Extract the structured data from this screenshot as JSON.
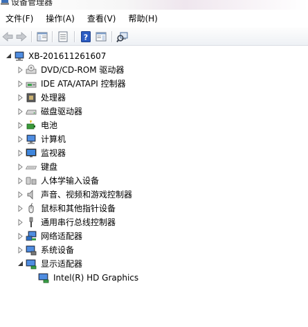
{
  "window": {
    "title": "设备管理器"
  },
  "menu": [
    {
      "label": "文件(F)"
    },
    {
      "label": "操作(A)"
    },
    {
      "label": "查看(V)"
    },
    {
      "label": "帮助(H)"
    }
  ],
  "toolbar": {
    "buttons": [
      "back-arrow-icon",
      "forward-arrow-icon",
      "show-hide-console-tree-icon",
      "properties-icon",
      "help-icon",
      "action-pane-icon",
      "scan-hardware-changes-icon"
    ]
  },
  "tree": {
    "root": {
      "label": "XB-201611261607",
      "expanded": true,
      "icon": "computer-icon"
    },
    "categories": [
      {
        "label": "DVD/CD-ROM 驱动器",
        "icon": "dvd-drive-icon"
      },
      {
        "label": "IDE ATA/ATAPI 控制器",
        "icon": "ide-controller-icon"
      },
      {
        "label": "处理器",
        "icon": "processor-icon"
      },
      {
        "label": "磁盘驱动器",
        "icon": "disk-drive-icon"
      },
      {
        "label": "电池",
        "icon": "battery-icon"
      },
      {
        "label": "计算机",
        "icon": "computer-icon"
      },
      {
        "label": "监视器",
        "icon": "monitor-icon"
      },
      {
        "label": "键盘",
        "icon": "keyboard-icon"
      },
      {
        "label": "人体学输入设备",
        "icon": "hid-icon"
      },
      {
        "label": "声音、视频和游戏控制器",
        "icon": "sound-icon"
      },
      {
        "label": "鼠标和其他指针设备",
        "icon": "mouse-icon"
      },
      {
        "label": "通用串行总线控制器",
        "icon": "usb-icon"
      },
      {
        "label": "网络适配器",
        "icon": "network-adapter-icon"
      },
      {
        "label": "系统设备",
        "icon": "system-device-icon"
      },
      {
        "label": "显示适配器",
        "icon": "display-adapter-icon",
        "expanded": true
      }
    ],
    "display_children": [
      {
        "label": "Intel(R) HD Graphics",
        "icon": "display-adapter-icon"
      }
    ]
  }
}
